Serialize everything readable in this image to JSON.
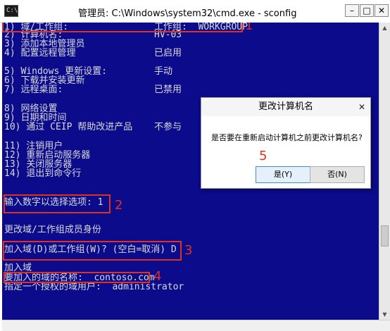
{
  "window": {
    "title": "管理员: C:\\Windows\\system32\\cmd.exe - sconfig",
    "icon_text": "C:\\",
    "minimize_glyph": "–",
    "maximize_glyph": "□",
    "close_glyph": "✕"
  },
  "menu": [
    {
      "label": "1) 域/工作组:",
      "value": "工作组:  WORKGROUP"
    },
    {
      "label": "2) 计算机名:",
      "value": "HV-03"
    },
    {
      "label": "3) 添加本地管理员",
      "value": ""
    },
    {
      "label": "4) 配置远程管理",
      "value": "已启用"
    },
    {
      "label": "5) Windows 更新设置:",
      "value": "手动"
    },
    {
      "label": "6) 下载并安装更新",
      "value": ""
    },
    {
      "label": "7) 远程桌面:",
      "value": "已禁用"
    },
    {
      "label": "8) 网络设置",
      "value": ""
    },
    {
      "label": "9) 日期和时间",
      "value": ""
    },
    {
      "label": "10) 通过 CEIP 帮助改进产品",
      "value": "不参与"
    },
    {
      "label": "11) 注销用户",
      "value": ""
    },
    {
      "label": "12) 重新启动服务器",
      "value": ""
    },
    {
      "label": "13) 关闭服务器",
      "value": ""
    },
    {
      "label": "14) 退出到命令行",
      "value": ""
    }
  ],
  "prompts": {
    "select_option": "输入数字以选择选项: 1",
    "change_membership": "更改域/工作组成员身份",
    "join_prompt": "加入域(D)或工作组(W)? (空白=取消) D",
    "join_domain": "加入域",
    "domain_name": "要加入的域的名称:  contoso.com",
    "auth_user": "指定一个授权的域用户:  administrator"
  },
  "annotations": [
    "1",
    "2",
    "3",
    "4",
    "5"
  ],
  "dialog": {
    "title": "更改计算机名",
    "message": "是否要在重新启动计算机之前更改计算机名?",
    "yes_label": "是(Y)",
    "no_label": "否(N)",
    "close_glyph": "✕"
  },
  "scrollbar": {
    "up_glyph": "▲",
    "down_glyph": "▼"
  },
  "colors": {
    "console_background": "#0b0b8c",
    "console_text": "#d9d9d9",
    "annotation_red": "#e0301e"
  }
}
